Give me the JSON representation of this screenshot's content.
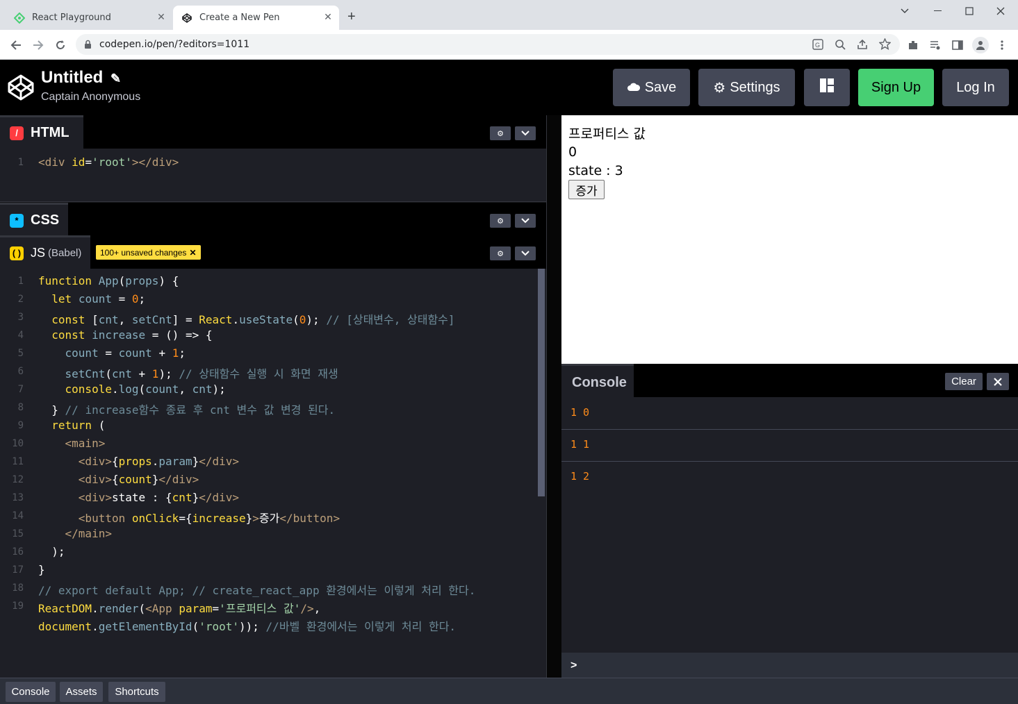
{
  "browser": {
    "tabs": [
      {
        "title": "React Playground"
      },
      {
        "title": "Create a New Pen"
      }
    ],
    "url": "codepen.io/pen/?editors=1011"
  },
  "header": {
    "title": "Untitled",
    "author": "Captain Anonymous",
    "buttons": {
      "save": "Save",
      "settings": "Settings",
      "signup": "Sign Up",
      "login": "Log In"
    }
  },
  "editors": {
    "html": {
      "label": "HTML",
      "lines": [
        "1"
      ]
    },
    "css": {
      "label": "CSS"
    },
    "js": {
      "label": "JS",
      "sublabel": "(Babel)",
      "badge": "100+ unsaved changes"
    }
  },
  "js_line_numbers": [
    "1",
    "2",
    "3",
    "4",
    "5",
    "6",
    "7",
    "8",
    "9",
    "10",
    "11",
    "12",
    "13",
    "14",
    "15",
    "16",
    "17",
    "18",
    "19"
  ],
  "preview": {
    "line1": "프로퍼티스 값",
    "line2": "0",
    "line3": "state : 3",
    "button": "증가"
  },
  "console": {
    "title": "Console",
    "clear": "Clear",
    "logs": [
      "1 0",
      "1 1",
      "1 2"
    ],
    "prompt": ">"
  },
  "footer": {
    "console": "Console",
    "assets": "Assets",
    "shortcuts": "Shortcuts"
  },
  "colors": {
    "accent_green": "#47cf73",
    "chrome_bg": "#dee1e6",
    "editor_bg": "#1e1f26",
    "button_bg": "#444857",
    "badge_yellow": "#ffdd40",
    "log_orange": "#ff8c1a"
  }
}
